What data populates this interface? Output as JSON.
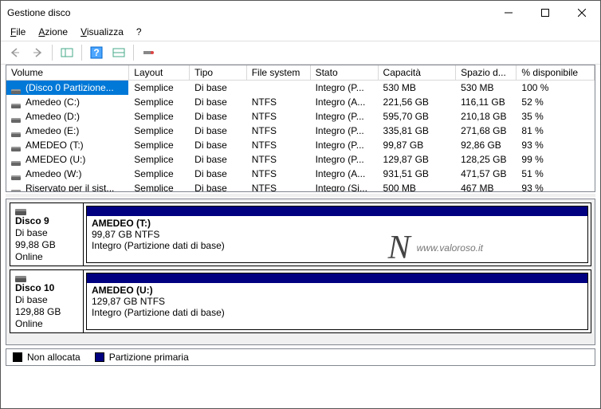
{
  "window": {
    "title": "Gestione disco"
  },
  "menu": {
    "file": "File",
    "azione": "Azione",
    "visualizza": "Visualizza",
    "help": "?"
  },
  "columns": {
    "volume": "Volume",
    "layout": "Layout",
    "tipo": "Tipo",
    "fs": "File system",
    "stato": "Stato",
    "capacita": "Capacità",
    "spazio": "Spazio d...",
    "pct": "% disponibile"
  },
  "rows": [
    {
      "vol": "(Disco 0 Partizione...",
      "layout": "Semplice",
      "tipo": "Di base",
      "fs": "",
      "stato": "Integro (P...",
      "cap": "530 MB",
      "free": "530 MB",
      "pct": "100 %",
      "selected": true
    },
    {
      "vol": "Amedeo (C:)",
      "layout": "Semplice",
      "tipo": "Di base",
      "fs": "NTFS",
      "stato": "Integro (A...",
      "cap": "221,56 GB",
      "free": "116,11 GB",
      "pct": "52 %"
    },
    {
      "vol": "Amedeo (D:)",
      "layout": "Semplice",
      "tipo": "Di base",
      "fs": "NTFS",
      "stato": "Integro (P...",
      "cap": "595,70 GB",
      "free": "210,18 GB",
      "pct": "35 %"
    },
    {
      "vol": "Amedeo (E:)",
      "layout": "Semplice",
      "tipo": "Di base",
      "fs": "NTFS",
      "stato": "Integro (P...",
      "cap": "335,81 GB",
      "free": "271,68 GB",
      "pct": "81 %"
    },
    {
      "vol": "AMEDEO (T:)",
      "layout": "Semplice",
      "tipo": "Di base",
      "fs": "NTFS",
      "stato": "Integro (P...",
      "cap": "99,87 GB",
      "free": "92,86 GB",
      "pct": "93 %"
    },
    {
      "vol": "AMEDEO (U:)",
      "layout": "Semplice",
      "tipo": "Di base",
      "fs": "NTFS",
      "stato": "Integro (P...",
      "cap": "129,87 GB",
      "free": "128,25 GB",
      "pct": "99 %"
    },
    {
      "vol": "Amedeo (W:)",
      "layout": "Semplice",
      "tipo": "Di base",
      "fs": "NTFS",
      "stato": "Integro (A...",
      "cap": "931,51 GB",
      "free": "471,57 GB",
      "pct": "51 %"
    },
    {
      "vol": "Riservato per il sist...",
      "layout": "Semplice",
      "tipo": "Di base",
      "fs": "NTFS",
      "stato": "Integro (Si...",
      "cap": "500 MB",
      "free": "467 MB",
      "pct": "93 %"
    }
  ],
  "disks": [
    {
      "name": "Disco 9",
      "type": "Di base",
      "size": "99,88 GB",
      "status": "Online",
      "vol": {
        "name": "AMEDEO  (T:)",
        "info": "99,87 GB NTFS",
        "status": "Integro (Partizione dati di base)"
      }
    },
    {
      "name": "Disco 10",
      "type": "Di base",
      "size": "129,88 GB",
      "status": "Online",
      "vol": {
        "name": "AMEDEO  (U:)",
        "info": "129,87 GB NTFS",
        "status": "Integro (Partizione dati di base)"
      }
    }
  ],
  "legend": {
    "unalloc": "Non allocata",
    "primary": "Partizione primaria"
  },
  "watermark": {
    "logo": "N",
    "url": "www.valoroso.it"
  }
}
